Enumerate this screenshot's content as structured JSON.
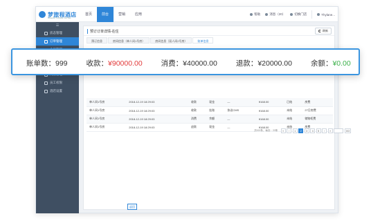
{
  "app": {
    "logo_text": "梦旅程酒店",
    "logo_sub": "DREAM TRAVEL HOTEL",
    "nav": [
      "首页",
      "前台",
      "营销",
      "应用"
    ],
    "nav_active_index": 1,
    "top_right": {
      "help": "帮助",
      "messages": "消息（20）",
      "switch_store": "切换门店",
      "user": "Thylane..."
    }
  },
  "sidebar": {
    "toggle": "☰",
    "items": [
      {
        "label": "房态管理",
        "icon": "room-icon"
      },
      {
        "label": "订单管理",
        "icon": "order-icon",
        "active": true
      },
      {
        "label": "会员管理",
        "icon": "member-icon"
      },
      {
        "label": "分销管理",
        "icon": "distribution-icon"
      },
      {
        "label": "财务管理",
        "icon": "finance-icon"
      },
      {
        "label": "门锁管理",
        "icon": "lock-icon"
      },
      {
        "label": "员工权限",
        "icon": "staff-icon"
      },
      {
        "label": "酒店设置",
        "icon": "settings-icon"
      }
    ]
  },
  "content": {
    "page_title": "预订订单详情-在住",
    "refresh_label": "刷新",
    "tabs": [
      "预订信息",
      "房间信息（单人间1号房）",
      "房间信息（双人间2号房）",
      "账单信息"
    ],
    "active_tab_index": 3,
    "rows": [
      [
        "单人间1号房",
        "2018-12-19 18:29:03",
        "收款",
        "现金",
        "—",
        "¥168.00",
        "已结",
        "房费"
      ],
      [
        "单人间1号房",
        "2018-12-19 18:29:03",
        "收款",
        "挂账",
        "协议CMS",
        "¥168.00",
        "未结",
        "27日房费"
      ],
      [
        "单人间1号房",
        "2018-12-19 18:29:03",
        "消费",
        "余额",
        "—",
        "¥168.00",
        "未结",
        "储物柜费"
      ],
      [
        "单人间1号房",
        "2018-12-19 18:29:03",
        "退款",
        "现金",
        "—",
        "¥168.00",
        "未结",
        "房费"
      ]
    ],
    "pager": {
      "info": "共520条，每页：20条",
      "buttons": [
        "«",
        "‹",
        "1",
        "2",
        "3",
        "4",
        "5",
        "›",
        "»"
      ],
      "active": "2",
      "go": "GO"
    },
    "back_label": "返回"
  },
  "summary": {
    "bill_count_label": "账单数：",
    "bill_count": "999",
    "collected_label": "收款：",
    "collected": "¥90000.00",
    "consumed_label": "消费：",
    "consumed": "¥40000.00",
    "refund_label": "退款：",
    "refund": "¥20000.00",
    "balance_label": "余额：",
    "balance": "¥0.00",
    "colors": {
      "accent": "#3a95e0",
      "negative": "#e23b3b",
      "positive": "#3cb04a"
    }
  }
}
